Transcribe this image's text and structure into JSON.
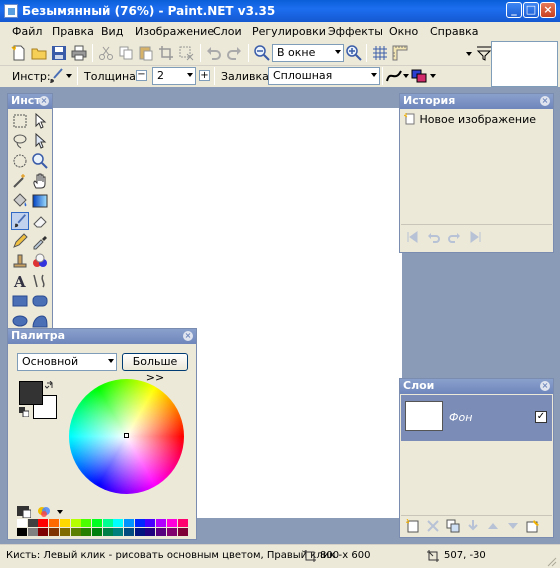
{
  "window": {
    "title": "Безымянный (76%) - Paint.NET v3.35"
  },
  "menu": [
    "Файл",
    "Правка",
    "Вид",
    "Изображение",
    "Слои",
    "Регулировки",
    "Эффекты",
    "Окно",
    "Справка"
  ],
  "toolbar1": {
    "zoom_mode": "В окне"
  },
  "toolbar2": {
    "tool_label": "Инстр:",
    "thickness_label": "Толщина:",
    "thickness_value": "2",
    "fill_label": "Заливка:",
    "fill_value": "Сплошная"
  },
  "tools_window": {
    "title": "Инст"
  },
  "history_window": {
    "title": "История",
    "items": [
      "Новое изображение"
    ]
  },
  "palette_window": {
    "title": "Палитра",
    "mode": "Основной",
    "more_button": "Больше >>"
  },
  "layers_window": {
    "title": "Слои",
    "layers": [
      {
        "name": "Фон",
        "visible": true
      }
    ]
  },
  "status": {
    "hint": "Кисть: Левый клик - рисовать основным цветом, Правый клик -",
    "image_size": "800 x 600",
    "cursor_pos": "507, -30"
  },
  "colors": {
    "primary": "#333333",
    "secondary": "#ffffff",
    "canvas_bg": "#8a9bb7",
    "palette_row1": [
      "#ffffff",
      "#404040",
      "#ff0000",
      "#ff6a00",
      "#ffd800",
      "#b6ff00",
      "#4cff00",
      "#00ff21",
      "#00ff90",
      "#00ffff",
      "#0094ff",
      "#0026ff",
      "#4800ff",
      "#b200ff",
      "#ff00dc",
      "#ff006e"
    ],
    "palette_row2": [
      "#000000",
      "#808080",
      "#7f0000",
      "#7f3300",
      "#7f6a00",
      "#5b7f00",
      "#267f00",
      "#007f0e",
      "#007f46",
      "#007f7f",
      "#004a7f",
      "#00137f",
      "#21007f",
      "#57007f",
      "#7f006e",
      "#7f0037"
    ]
  }
}
